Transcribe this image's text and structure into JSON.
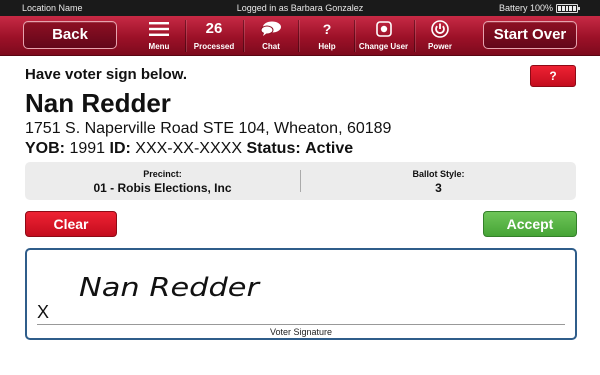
{
  "status_bar": {
    "location": "Location Name",
    "logged_in": "Logged in as Barbara Gonzalez",
    "battery": "Battery 100%"
  },
  "toolbar": {
    "back_label": "Back",
    "menu_label": "Menu",
    "processed_count": "26",
    "processed_label": "Processed",
    "chat_label": "Chat",
    "help_glyph": "?",
    "help_label": "Help",
    "change_user_label": "Change User",
    "power_label": "Power",
    "start_over_label": "Start Over"
  },
  "main": {
    "prompt": "Have voter sign below.",
    "help_button": "?",
    "voter_name": "Nan Redder",
    "address": "1751 S. Naperville Road STE 104, Wheaton, 60189",
    "yob_label": "YOB:",
    "yob_value": "1991",
    "id_label": "ID:",
    "id_value": "XXX-XX-XXXX",
    "status_label": "Status:",
    "status_value": "Active",
    "precinct_label": "Precinct:",
    "precinct_value": "01 - Robis Elections, Inc",
    "ballot_style_label": "Ballot Style:",
    "ballot_style_value": "3",
    "clear_label": "Clear",
    "accept_label": "Accept",
    "signature_mark": "X",
    "signature_ink": "Nan Redder",
    "signature_caption": "Voter Signature"
  },
  "colors": {
    "toolbar_red": "#9c1128",
    "button_red": "#e01a2c",
    "accept_green": "#5cb548",
    "signature_border": "#2f5d8a"
  },
  "icons": [
    "hamburger-icon",
    "chat-bubble-icon",
    "question-icon",
    "change-user-icon",
    "power-icon",
    "battery-icon"
  ]
}
